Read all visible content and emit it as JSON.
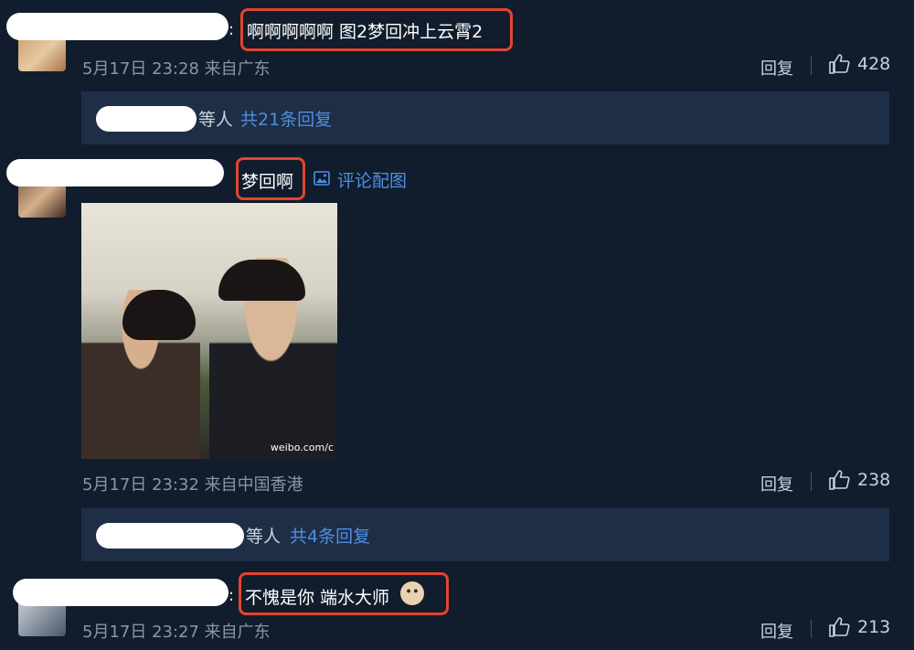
{
  "comments": [
    {
      "text": "啊啊啊啊啊 图2梦回冲上云霄2",
      "colon": ":",
      "meta": "5月17日 23:28 来自广东",
      "reply_label": "回复",
      "likes": "428",
      "replies": {
        "etc": "等人",
        "total": "共21条回复"
      }
    },
    {
      "text": "梦回啊",
      "colon": ":",
      "pic_link": "评论配图",
      "photo_watermark": "weibo.com/c",
      "meta": "5月17日 23:32 来自中国香港",
      "reply_label": "回复",
      "likes": "238",
      "replies": {
        "etc": "等人",
        "total": "共4条回复"
      }
    },
    {
      "text": "不愧是你 端水大师",
      "colon": ":",
      "meta": "5月17日 23:27 来自广东",
      "reply_label": "回复",
      "likes": "213"
    }
  ],
  "colors": {
    "background": "#111d2c",
    "replies_box": "#1e2e46",
    "highlight": "#e1452f",
    "link": "#4f8fe0",
    "meta": "#8a96a6"
  },
  "icons": [
    "thumbs-up-icon",
    "image-icon",
    "cat-emoji-icon"
  ]
}
